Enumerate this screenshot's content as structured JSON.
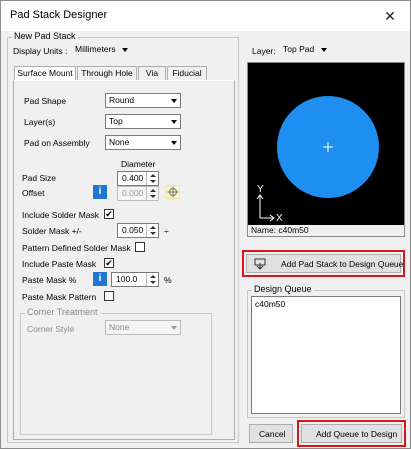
{
  "window": {
    "title": "Pad Stack Designer",
    "close_glyph": "✕"
  },
  "left_group": {
    "title": "New Pad Stack"
  },
  "units": {
    "label": "Display Units :",
    "value": "Millimeters"
  },
  "tabs": [
    "Surface Mount",
    "Through Hole",
    "Via",
    "Fiducial"
  ],
  "pad_shape": {
    "label": "Pad Shape",
    "value": "Round"
  },
  "layers": {
    "label": "Layer(s)",
    "value": "Top"
  },
  "pad_on_assembly": {
    "label": "Pad on Assembly",
    "value": "None"
  },
  "diameter_header": "Diameter",
  "pad_size": {
    "label": "Pad Size",
    "value": "0.400"
  },
  "offset": {
    "label": "Offset",
    "value": "0.000",
    "info_glyph": "i"
  },
  "include_solder_mask": {
    "label": "Include Solder Mask",
    "checked": "✔"
  },
  "solder_mask": {
    "label": "Solder Mask +/-",
    "value": "0.050",
    "unit": "÷"
  },
  "pattern_defined": {
    "label": "Pattern Defined Solder Mask"
  },
  "include_paste_mask": {
    "label": "Include Paste Mask",
    "checked": "✔"
  },
  "paste_mask": {
    "label": "Paste Mask %",
    "value": "100.0",
    "unit": "%",
    "info_glyph": "i"
  },
  "paste_mask_pattern": {
    "label": "Paste Mask Pattern"
  },
  "corner": {
    "title": "Corner Treatment",
    "style_label": "Corner Style",
    "value": "None"
  },
  "layer_select": {
    "label": "Layer:",
    "value": "Top Pad"
  },
  "preview": {
    "name": "Name: c40m50",
    "x_axis": "X",
    "y_axis": "Y",
    "pad_color": "#1e8ff0"
  },
  "add_pad_button": "Add Pad Stack to Design Queue",
  "design_queue": {
    "title": "Design Queue",
    "items": [
      "c40m50"
    ]
  },
  "cancel_button": "Cancel",
  "add_queue_button": "Add Queue to Design",
  "highlight_color": "#d8171d"
}
